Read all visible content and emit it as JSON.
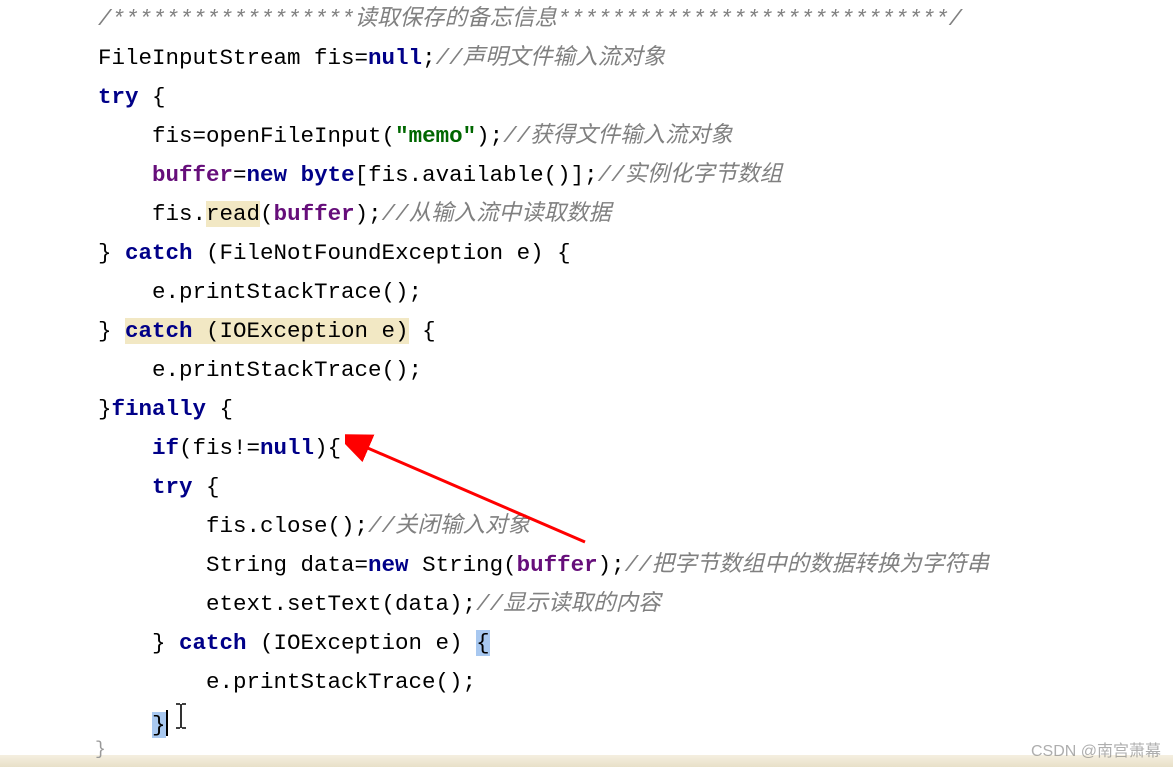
{
  "code": {
    "l1_comment": "/******************读取保存的备忘信息*****************************/",
    "l2a": "FileInputStream fis=",
    "l2_null": "null",
    "l2b": ";",
    "l2_cmt": "//声明文件输入流对象",
    "l3_try": "try",
    "l3b": " {",
    "l4a": "    fis=openFileInput(",
    "l4_str": "\"memo\"",
    "l4b": ");",
    "l4_cmt": "//获得文件输入流对象",
    "l5a": "    ",
    "l5_buf": "buffer",
    "l5b": "=",
    "l5_new": "new",
    "l5c": " ",
    "l5_byte": "byte",
    "l5d": "[fis.available()];",
    "l5_cmt": "//实例化字节数组",
    "l6a": "    fis.",
    "l6_read": "read",
    "l6b": "(",
    "l6_buf": "buffer",
    "l6c": ");",
    "l6_cmt": "//从输入流中读取数据",
    "l7a": "} ",
    "l7_catch": "catch",
    "l7b": " (FileNotFoundException e) {",
    "l8": "    e.printStackTrace();",
    "l9a": "} ",
    "l9_catch": "catch",
    "l9b": " (IOException e)",
    "l9c": " {",
    "l10": "    e.printStackTrace();",
    "l11a": "}",
    "l11_fin": "finally",
    "l11b": " {",
    "l12a": "    ",
    "l12_if": "if",
    "l12b": "(fis!=",
    "l12_null": "null",
    "l12c": "){",
    "l13a": "    ",
    "l13_try": "try",
    "l13b": " {",
    "l14a": "        fis.close();",
    "l14_cmt": "//关闭输入对象",
    "l15a": "        String data=",
    "l15_new": "new",
    "l15b": " String(",
    "l15_buf": "buffer",
    "l15c": ");",
    "l15_cmt": "//把字节数组中的数据转换为字符串",
    "l16a": "        etext.setText(data);",
    "l16_cmt": "//显示读取的内容",
    "l17a": "    } ",
    "l17_catch": "catch",
    "l17b": " (IOException e) ",
    "l17_brace": "{",
    "l18": "        e.printStackTrace();",
    "l19a": "    ",
    "l19_brace": "}"
  },
  "watermark": "CSDN @南宫萧幕"
}
